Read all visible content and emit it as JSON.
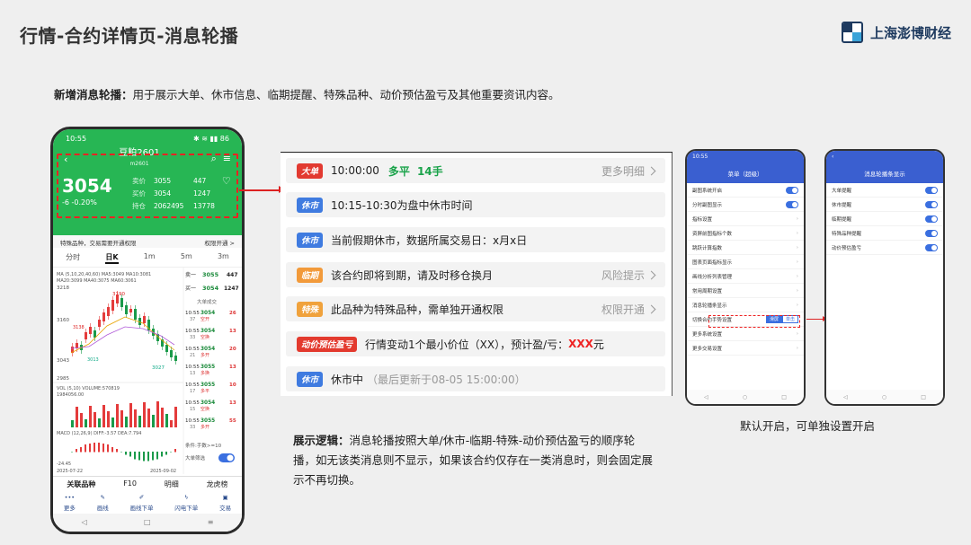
{
  "slide": {
    "title": "行情-合约详情页-消息轮播",
    "brand": "上海澎博财经",
    "intro_label": "新增消息轮播：",
    "intro_text": "用于展示大单、休市信息、临期提醒、特殊品种、动价预估盈亏及其他重要资讯内容。",
    "logic_label": "展示逻辑：",
    "logic_text": "消息轮播按照大单/休市-临期-特殊-动价预估盈亏的顺序轮播，如无该类消息则不显示，如果该合约仅存在一类消息时，则会固定展示不再切换。",
    "caption": "默认开启，可单独设置开启"
  },
  "phone": {
    "time": "10:55",
    "contract": "豆粕2601",
    "contract_sub": "m2601",
    "price": "3054",
    "change": "-6  -0.20%",
    "ask_label": "卖价",
    "ask": "3055",
    "ask_vol": "447",
    "bid_label": "买价",
    "bid": "3054",
    "bid_vol": "1247",
    "oi_label": "持仓",
    "oi": "2062495",
    "oi_chg": "13778",
    "tip_left": "特殊品种，交易需要开通权限",
    "tip_right": "权限开通 >",
    "tabs": [
      "分时",
      "日K",
      "1m",
      "5m",
      "3m"
    ],
    "ma_line": "MA (5,10,20,40,60) MA5:3049 MA10:3081",
    "ma_line2": "MA20:3099 MA40:3075 MA60:3061",
    "y_top": "3218",
    "y_1": "3160",
    "y_2": "3043",
    "y_low": "2985",
    "hi_label": "3190",
    "lo_label": "3027",
    "mark_3138": "3138",
    "mark_3013": "3013",
    "vol_label": "VOL (5,10) VOLUME:570819",
    "vol_val": "1984056.00",
    "macd_label": "MACD (12,26,9) DIFF:-3.57 DEA:7.794",
    "macd_neg": "-24.45",
    "date_left": "2025-07-22",
    "date_right": "2025-09-02",
    "book_sell": "卖一",
    "book_sell_p": "3055",
    "book_sell_v": "447",
    "book_buy": "买一",
    "book_buy_p": "3054",
    "book_buy_v": "1247",
    "trades_title": "大单成交",
    "trades": [
      {
        "t": "10:55",
        "p": "3054",
        "v": "26",
        "n": "37",
        "k": "空开"
      },
      {
        "t": "10:55",
        "p": "3054",
        "v": "13",
        "n": "33",
        "k": "空换"
      },
      {
        "t": "10:55",
        "p": "3054",
        "v": "20",
        "n": "21",
        "k": "多开"
      },
      {
        "t": "10:55",
        "p": "3055",
        "v": "13",
        "n": "13",
        "k": "多换"
      },
      {
        "t": "10:55",
        "p": "3055",
        "v": "10",
        "n": "17",
        "k": "多平"
      },
      {
        "t": "10:55",
        "p": "3054",
        "v": "13",
        "n": "15",
        "k": "空换"
      },
      {
        "t": "10:55",
        "p": "3055",
        "v": "55",
        "n": "33",
        "k": "多开"
      }
    ],
    "filter_text": "条件:手数>=10",
    "big_filter": "大单筛选",
    "bottom_tabs": [
      "关联品种",
      "F10",
      "明细",
      "龙虎榜"
    ],
    "tools": [
      "更多",
      "画线",
      "画线下单",
      "闪电下单",
      "交易"
    ],
    "sys_nav": [
      "◁",
      "□",
      "≡"
    ]
  },
  "notices": [
    {
      "badge": "大单",
      "color": "#e23a31",
      "time": "10:00:00",
      "act": "多平",
      "qty": "14手",
      "right": "更多明细"
    },
    {
      "badge": "休市",
      "color": "#3f7be0",
      "text": "10:15-10:30为盘中休市时间"
    },
    {
      "badge": "休市",
      "color": "#3f7be0",
      "text": "当前假期休市，数据所属交易日：x月x日"
    },
    {
      "badge": "临期",
      "color": "#f29a3a",
      "text": "该合约即将到期，请及时移仓换月",
      "right": "风险提示"
    },
    {
      "badge": "特殊",
      "color": "#f0a23c",
      "text": "此品种为特殊品种，需单独开通权限",
      "right": "权限开通"
    },
    {
      "badge": "动价预估盈亏",
      "color": "#e33a2e",
      "text": "行情变动1个最小价位（XX），预计盈/亏：",
      "red": "XXX",
      "tail": "元"
    },
    {
      "badge": "休市",
      "color": "#3f7be0",
      "text": "休市中",
      "gray": "（最后更新于08-05 15:00:00）"
    }
  ],
  "settings_left": {
    "title": "菜单（超级）",
    "items": [
      "副图系统开启",
      "分时副图显示",
      "指标设置",
      "资屏前图指标个数",
      "跳跃计算指数",
      "图表页面指标显示",
      "画线分析列表管理",
      "常用周期设置",
      "消息轮播条显示",
      "切换合约手势设置",
      "更多系统设置",
      "更多交易设置"
    ],
    "segment": [
      "滑屏",
      "单击"
    ]
  },
  "settings_right": {
    "title": "消息轮播条显示",
    "items": [
      "大单提醒",
      "休市提醒",
      "临期提醒",
      "特殊品种提醒",
      "动价预估盈亏"
    ]
  }
}
